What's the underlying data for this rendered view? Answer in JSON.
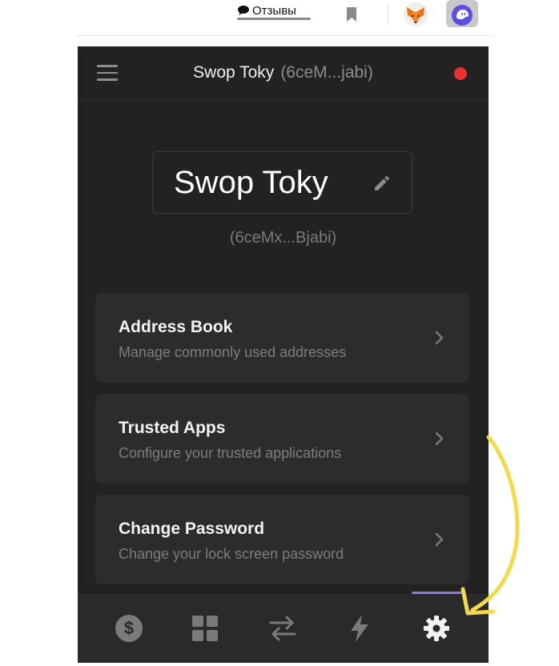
{
  "browser_toolbar": {
    "feedback_label": "Отзывы"
  },
  "popup": {
    "header": {
      "account_name": "Swop Toky",
      "account_address_short": "(6ceM...jabi)",
      "status_color": "#e8312f"
    },
    "account_name_display": "Swop Toky",
    "account_address": "(6ceMx...Bjabi)",
    "settings_items": [
      {
        "title": "Address Book",
        "description": "Manage commonly used addresses"
      },
      {
        "title": "Trusted Apps",
        "description": "Configure your trusted applications"
      },
      {
        "title": "Change Password",
        "description": "Change your lock screen password"
      }
    ],
    "bottom_nav": {
      "items": [
        {
          "icon": "dollar-icon"
        },
        {
          "icon": "grid-icon"
        },
        {
          "icon": "swap-icon"
        },
        {
          "icon": "lightning-icon"
        },
        {
          "icon": "gear-icon",
          "active": true
        }
      ],
      "active_color": "#8a7ae8"
    }
  },
  "annotation": {
    "arrow_color": "#f2d94e"
  }
}
